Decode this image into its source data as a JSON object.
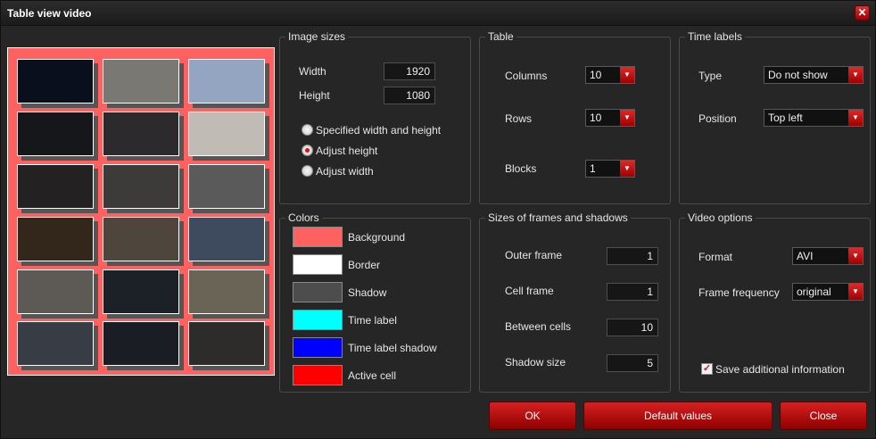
{
  "window": {
    "title": "Table view video",
    "close_glyph": "✕"
  },
  "preview": {
    "background": "#ff6060",
    "thumbs": [
      [
        "#0a0f1e",
        "#7a7872",
        "#93a5c0"
      ],
      [
        "#15171b",
        "#2c2a2c",
        "#c0bcb5"
      ],
      [
        "#242122",
        "#3d3b3a",
        "#5a5a5a"
      ],
      [
        "#33261b",
        "#4e463d",
        "#3e4a5e"
      ],
      [
        "#5d5a55",
        "#1c2127",
        "#6a6457"
      ],
      [
        "#383c45",
        "#1a1d24",
        "#2d2c2b"
      ]
    ]
  },
  "image_sizes": {
    "title": "Image sizes",
    "width_label": "Width",
    "width_value": "1920",
    "height_label": "Height",
    "height_value": "1080",
    "options": [
      "Specified width and height",
      "Adjust height",
      "Adjust width"
    ],
    "selected_index": 1
  },
  "colors": {
    "title": "Colors",
    "items": [
      {
        "label": "Background",
        "color": "#ff6060"
      },
      {
        "label": "Border",
        "color": "#ffffff"
      },
      {
        "label": "Shadow",
        "color": "#4d4d4d"
      },
      {
        "label": "Time label",
        "color": "#00ffff"
      },
      {
        "label": "Time label shadow",
        "color": "#0000ff"
      },
      {
        "label": "Active cell",
        "color": "#ff0000"
      }
    ]
  },
  "table": {
    "title": "Table",
    "columns_label": "Columns",
    "columns_value": "10",
    "rows_label": "Rows",
    "rows_value": "10",
    "blocks_label": "Blocks",
    "blocks_value": "1"
  },
  "frames": {
    "title": "Sizes of frames and shadows",
    "outer_frame_label": "Outer frame",
    "outer_frame_value": "1",
    "cell_frame_label": "Cell frame",
    "cell_frame_value": "1",
    "between_cells_label": "Between cells",
    "between_cells_value": "10",
    "shadow_size_label": "Shadow size",
    "shadow_size_value": "5"
  },
  "time_labels": {
    "title": "Time labels",
    "type_label": "Type",
    "type_value": "Do not show",
    "position_label": "Position",
    "position_value": "Top left"
  },
  "video_options": {
    "title": "Video options",
    "format_label": "Format",
    "format_value": "AVI",
    "freq_label": "Frame frequency",
    "freq_value": "original",
    "save_label": "Save additional information",
    "save_checked": true
  },
  "buttons": {
    "ok": "OK",
    "defaults": "Default values",
    "close": "Close"
  },
  "icons": {
    "dropdown_arrow": "▼",
    "check": "✓"
  }
}
